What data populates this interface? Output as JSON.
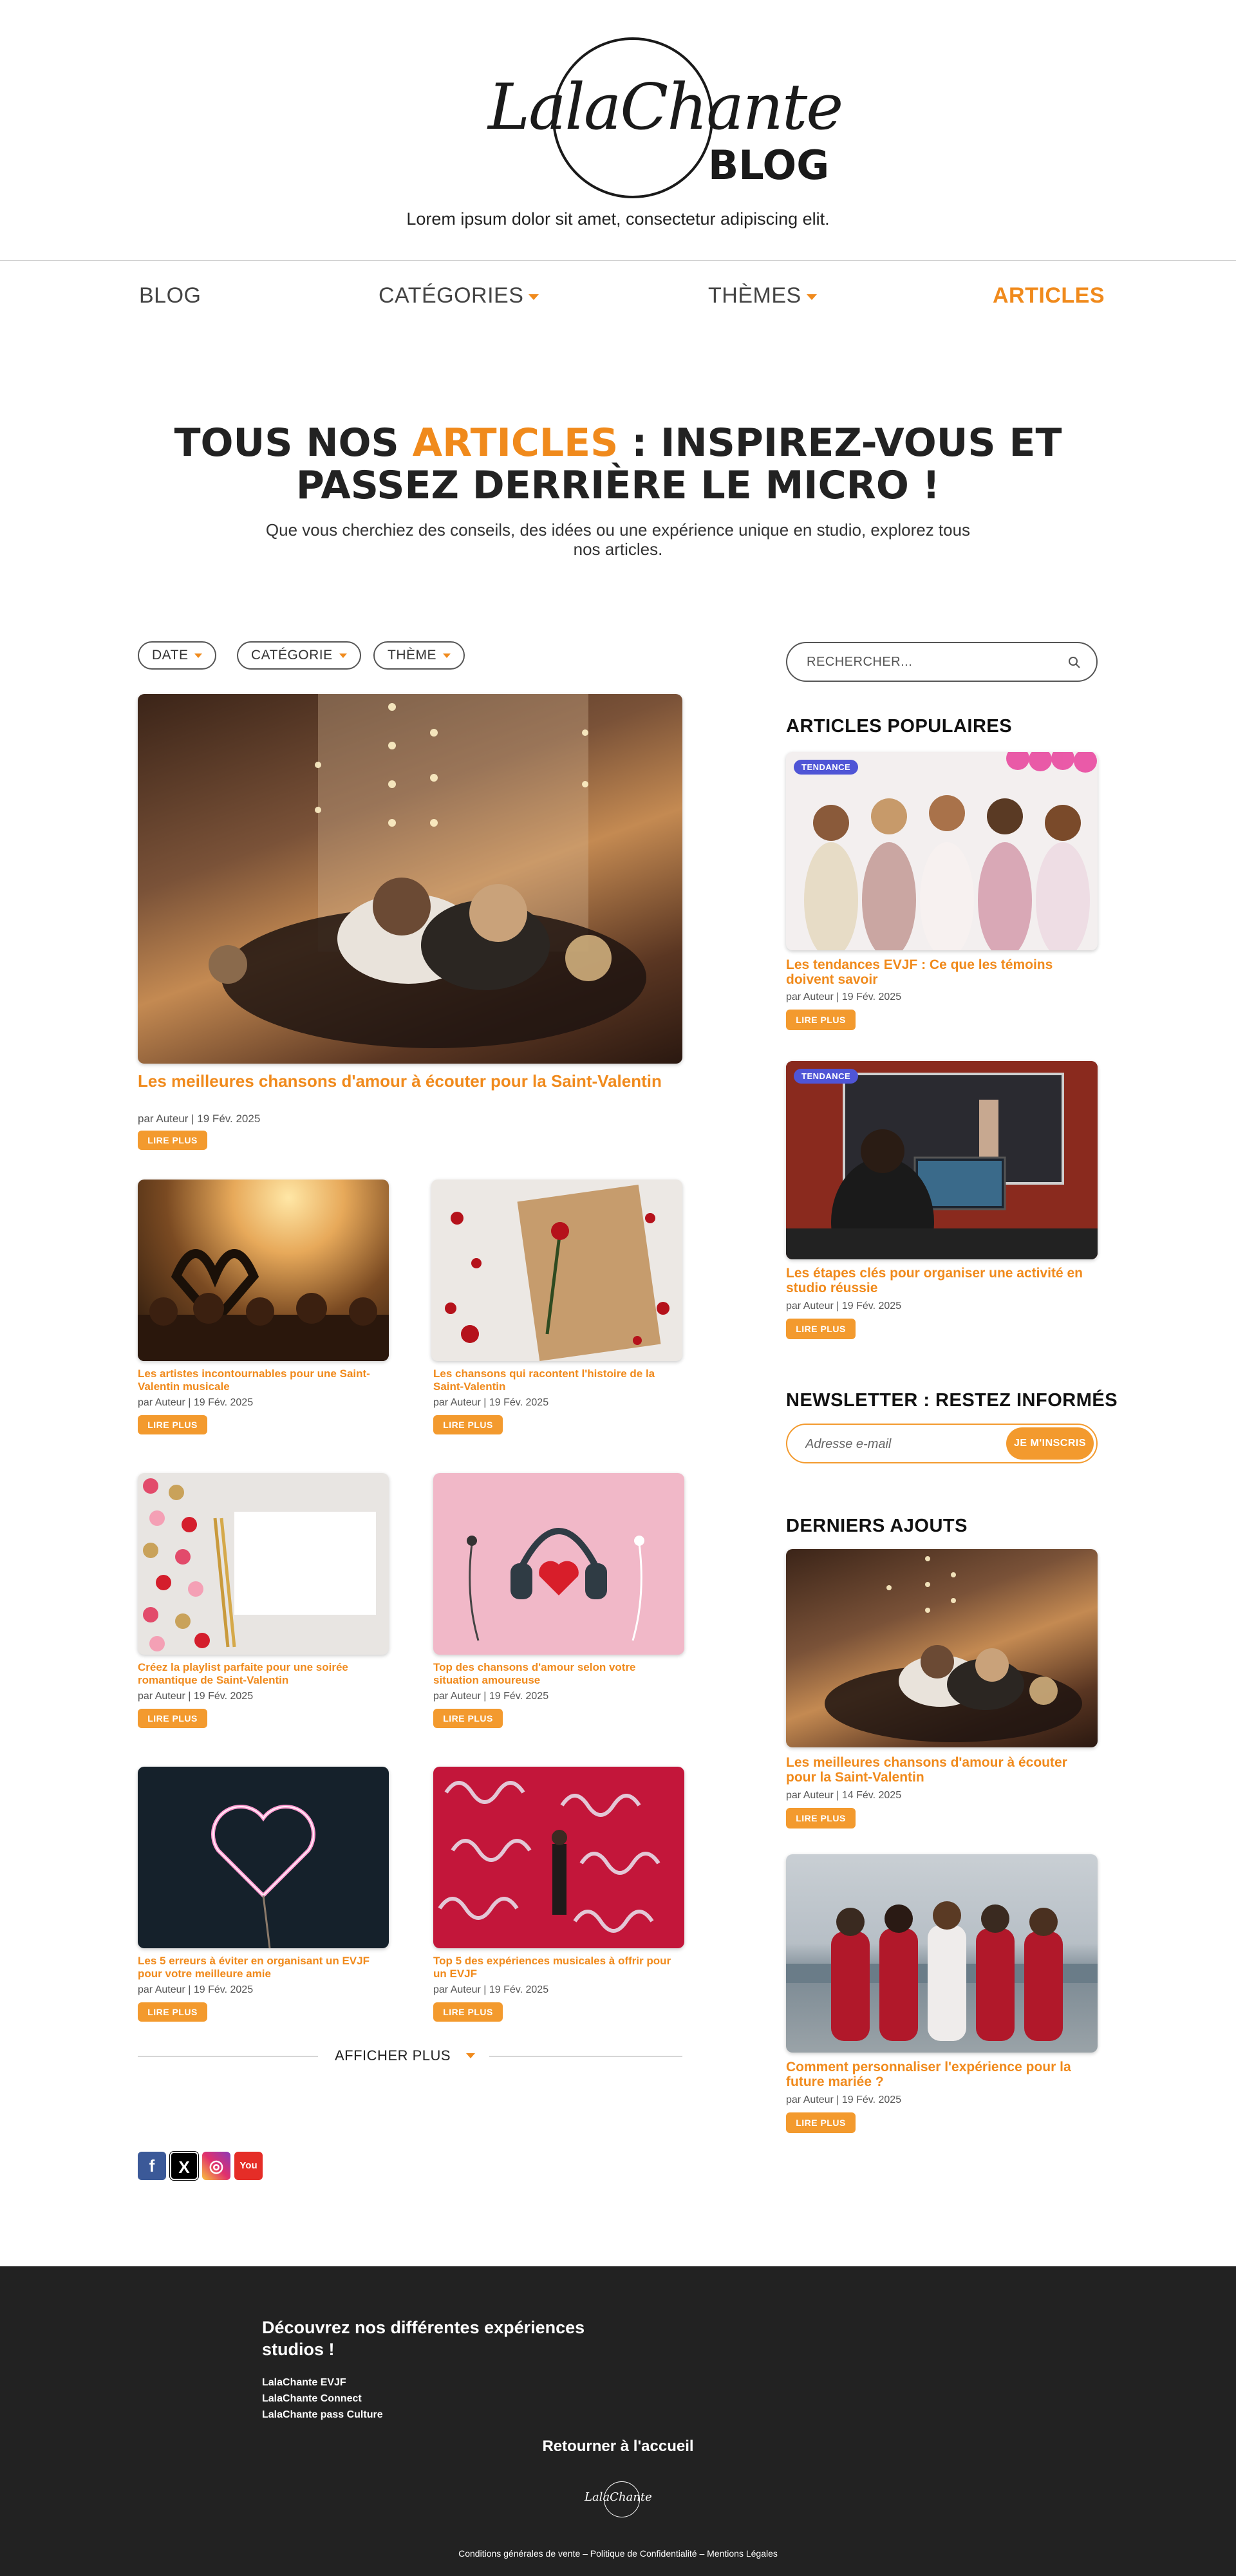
{
  "brand": {
    "logo_script": "LalaChante",
    "logo_word": "BLOG",
    "tagline": "Lorem ipsum dolor sit amet, consectetur adipiscing elit."
  },
  "nav": {
    "blog": "BLOG",
    "categories": "CATÉGORIES",
    "themes": "THÈMES",
    "articles": "ARTICLES"
  },
  "hero": {
    "title_prefix": "TOUS NOS ",
    "title_accent": "ARTICLES",
    "title_line1_rest": " : INSPIREZ-VOUS ET",
    "title_line2": "PASSEZ DERRIÈRE LE MICRO !",
    "subtitle": "Que vous cherchiez des conseils, des idées ou une expérience unique en studio, explorez tous nos articles."
  },
  "filters": {
    "date": "DATE",
    "category": "CATÉGORIE",
    "theme": "THÈME"
  },
  "featured": {
    "title": "Les meilleures chansons d'amour à écouter pour la Saint-Valentin",
    "meta": "par Auteur | 19 Fév. 2025",
    "button": "LIRE PLUS"
  },
  "grid": [
    {
      "title": "Les artistes incontournables pour une Saint-Valentin musicale",
      "meta": "par Auteur | 19 Fév. 2025",
      "button": "LIRE PLUS"
    },
    {
      "title": "Les chansons qui racontent l'histoire de la Saint-Valentin",
      "meta": "par Auteur | 19 Fév. 2025",
      "button": "LIRE PLUS"
    },
    {
      "title": "Créez la playlist parfaite pour une soirée romantique de Saint-Valentin",
      "meta": "par Auteur | 19 Fév. 2025",
      "button": "LIRE PLUS"
    },
    {
      "title": "Top des chansons d'amour selon votre situation amoureuse",
      "meta": "par Auteur | 19 Fév. 2025",
      "button": "LIRE PLUS"
    },
    {
      "title": "Les 5 erreurs à éviter en organisant un EVJF pour votre meilleure amie",
      "meta": "par Auteur | 19 Fév. 2025",
      "button": "LIRE PLUS"
    },
    {
      "title": "Top 5 des expériences musicales à offrir pour un EVJF",
      "meta": "par Auteur | 19 Fév. 2025",
      "button": "LIRE PLUS"
    }
  ],
  "more": {
    "label": "AFFICHER PLUS"
  },
  "social": {
    "facebook": "f",
    "x": "X",
    "instagram": "◎",
    "youtube": "You"
  },
  "sidebar": {
    "search_placeholder": "RECHERCHER...",
    "popular_heading": "ARTICLES POPULAIRES",
    "popular": [
      {
        "badge": "TENDANCE",
        "title": "Les tendances EVJF : Ce que les témoins doivent savoir",
        "meta": "par Auteur | 19 Fév. 2025",
        "button": "LIRE PLUS"
      },
      {
        "badge": "TENDANCE",
        "title": "Les étapes clés pour organiser une activité en studio réussie",
        "meta": "par Auteur | 19 Fév. 2025",
        "button": "LIRE PLUS"
      }
    ],
    "newsletter_heading": "NEWSLETTER : RESTEZ INFORMÉS",
    "newsletter_placeholder": "Adresse e-mail",
    "newsletter_button": "JE M'INSCRIS",
    "latest_heading": "DERNIERS AJOUTS",
    "latest": [
      {
        "title": "Les meilleures chansons d'amour à écouter pour la Saint-Valentin",
        "meta": "par Auteur | 14 Fév. 2025",
        "button": "LIRE PLUS"
      },
      {
        "title": "Comment personnaliser l'expérience pour la future mariée ?",
        "meta": "par Auteur | 19 Fév. 2025",
        "button": "LIRE PLUS"
      }
    ]
  },
  "footer": {
    "heading": "Découvrez nos différentes expériences studios !",
    "links": [
      "LalaChante EVJF",
      "LalaChante Connect",
      "LalaChante pass Culture"
    ],
    "back": "Retourner à l'accueil",
    "logo": "LalaChante",
    "legal": "Conditions générales de vente – Politique de Confidentialité – Mentions Légales"
  },
  "colors": {
    "accent": "#f08a1c",
    "badge": "#4f55d6",
    "footer_bg": "#222222"
  },
  "icons": {
    "search": "search-icon",
    "caret": "chevron-down-icon"
  }
}
